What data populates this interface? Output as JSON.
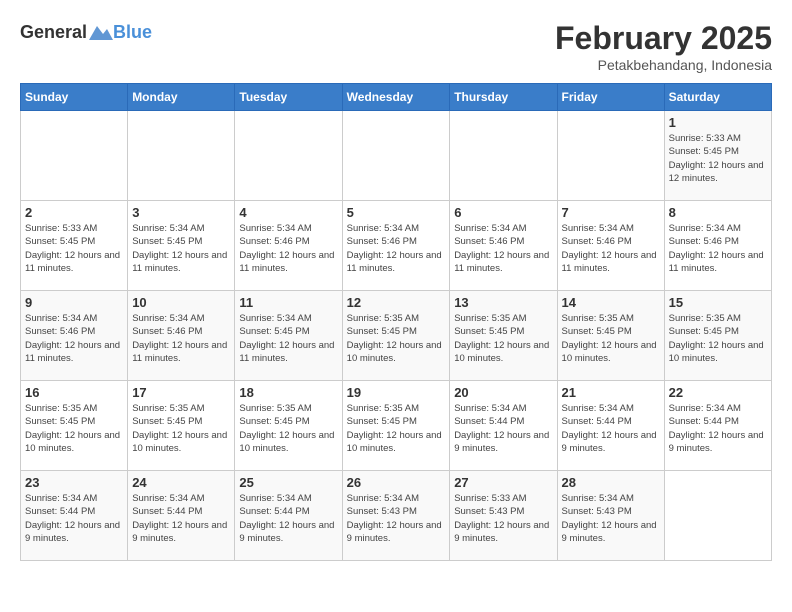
{
  "header": {
    "logo_general": "General",
    "logo_blue": "Blue",
    "month_year": "February 2025",
    "location": "Petakbehandang, Indonesia"
  },
  "weekdays": [
    "Sunday",
    "Monday",
    "Tuesday",
    "Wednesday",
    "Thursday",
    "Friday",
    "Saturday"
  ],
  "weeks": [
    [
      {
        "day": "",
        "info": ""
      },
      {
        "day": "",
        "info": ""
      },
      {
        "day": "",
        "info": ""
      },
      {
        "day": "",
        "info": ""
      },
      {
        "day": "",
        "info": ""
      },
      {
        "day": "",
        "info": ""
      },
      {
        "day": "1",
        "info": "Sunrise: 5:33 AM\nSunset: 5:45 PM\nDaylight: 12 hours\nand 12 minutes."
      }
    ],
    [
      {
        "day": "2",
        "info": "Sunrise: 5:33 AM\nSunset: 5:45 PM\nDaylight: 12 hours\nand 11 minutes."
      },
      {
        "day": "3",
        "info": "Sunrise: 5:34 AM\nSunset: 5:45 PM\nDaylight: 12 hours\nand 11 minutes."
      },
      {
        "day": "4",
        "info": "Sunrise: 5:34 AM\nSunset: 5:46 PM\nDaylight: 12 hours\nand 11 minutes."
      },
      {
        "day": "5",
        "info": "Sunrise: 5:34 AM\nSunset: 5:46 PM\nDaylight: 12 hours\nand 11 minutes."
      },
      {
        "day": "6",
        "info": "Sunrise: 5:34 AM\nSunset: 5:46 PM\nDaylight: 12 hours\nand 11 minutes."
      },
      {
        "day": "7",
        "info": "Sunrise: 5:34 AM\nSunset: 5:46 PM\nDaylight: 12 hours\nand 11 minutes."
      },
      {
        "day": "8",
        "info": "Sunrise: 5:34 AM\nSunset: 5:46 PM\nDaylight: 12 hours\nand 11 minutes."
      }
    ],
    [
      {
        "day": "9",
        "info": "Sunrise: 5:34 AM\nSunset: 5:46 PM\nDaylight: 12 hours\nand 11 minutes."
      },
      {
        "day": "10",
        "info": "Sunrise: 5:34 AM\nSunset: 5:46 PM\nDaylight: 12 hours\nand 11 minutes."
      },
      {
        "day": "11",
        "info": "Sunrise: 5:34 AM\nSunset: 5:45 PM\nDaylight: 12 hours\nand 11 minutes."
      },
      {
        "day": "12",
        "info": "Sunrise: 5:35 AM\nSunset: 5:45 PM\nDaylight: 12 hours\nand 10 minutes."
      },
      {
        "day": "13",
        "info": "Sunrise: 5:35 AM\nSunset: 5:45 PM\nDaylight: 12 hours\nand 10 minutes."
      },
      {
        "day": "14",
        "info": "Sunrise: 5:35 AM\nSunset: 5:45 PM\nDaylight: 12 hours\nand 10 minutes."
      },
      {
        "day": "15",
        "info": "Sunrise: 5:35 AM\nSunset: 5:45 PM\nDaylight: 12 hours\nand 10 minutes."
      }
    ],
    [
      {
        "day": "16",
        "info": "Sunrise: 5:35 AM\nSunset: 5:45 PM\nDaylight: 12 hours\nand 10 minutes."
      },
      {
        "day": "17",
        "info": "Sunrise: 5:35 AM\nSunset: 5:45 PM\nDaylight: 12 hours\nand 10 minutes."
      },
      {
        "day": "18",
        "info": "Sunrise: 5:35 AM\nSunset: 5:45 PM\nDaylight: 12 hours\nand 10 minutes."
      },
      {
        "day": "19",
        "info": "Sunrise: 5:35 AM\nSunset: 5:45 PM\nDaylight: 12 hours\nand 10 minutes."
      },
      {
        "day": "20",
        "info": "Sunrise: 5:34 AM\nSunset: 5:44 PM\nDaylight: 12 hours\nand 9 minutes."
      },
      {
        "day": "21",
        "info": "Sunrise: 5:34 AM\nSunset: 5:44 PM\nDaylight: 12 hours\nand 9 minutes."
      },
      {
        "day": "22",
        "info": "Sunrise: 5:34 AM\nSunset: 5:44 PM\nDaylight: 12 hours\nand 9 minutes."
      }
    ],
    [
      {
        "day": "23",
        "info": "Sunrise: 5:34 AM\nSunset: 5:44 PM\nDaylight: 12 hours\nand 9 minutes."
      },
      {
        "day": "24",
        "info": "Sunrise: 5:34 AM\nSunset: 5:44 PM\nDaylight: 12 hours\nand 9 minutes."
      },
      {
        "day": "25",
        "info": "Sunrise: 5:34 AM\nSunset: 5:44 PM\nDaylight: 12 hours\nand 9 minutes."
      },
      {
        "day": "26",
        "info": "Sunrise: 5:34 AM\nSunset: 5:43 PM\nDaylight: 12 hours\nand 9 minutes."
      },
      {
        "day": "27",
        "info": "Sunrise: 5:33 AM\nSunset: 5:43 PM\nDaylight: 12 hours\nand 9 minutes."
      },
      {
        "day": "28",
        "info": "Sunrise: 5:34 AM\nSunset: 5:43 PM\nDaylight: 12 hours\nand 9 minutes."
      },
      {
        "day": "",
        "info": ""
      }
    ]
  ]
}
